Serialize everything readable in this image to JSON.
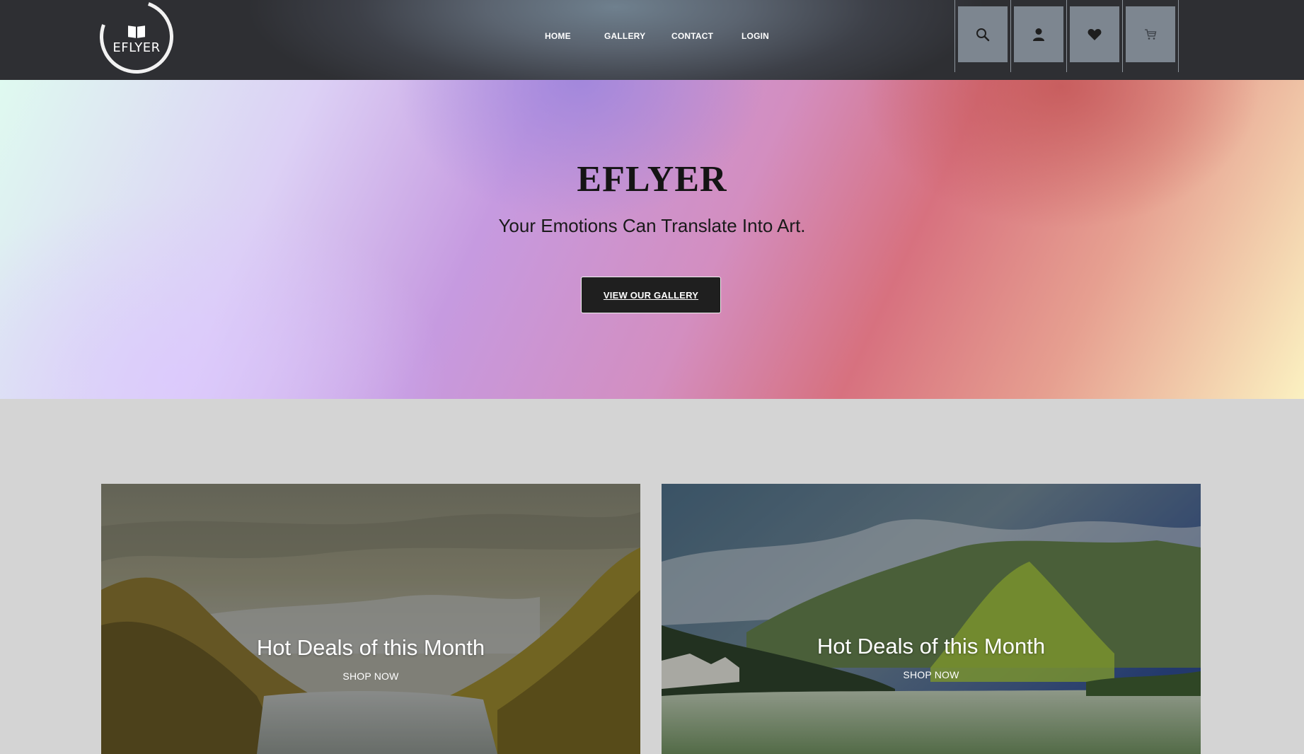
{
  "header": {
    "logo_text": "EFLYER",
    "nav": [
      {
        "label": "HOME"
      },
      {
        "label": "GALLERY"
      },
      {
        "label": "CONTACT"
      },
      {
        "label": "LOGIN"
      }
    ],
    "icons": [
      "search-icon",
      "user-icon",
      "heart-icon",
      "cart-icon"
    ]
  },
  "hero": {
    "title": "EFLYER",
    "subtitle": "Your Emotions Can Translate Into Art.",
    "button": "VIEW OUR GALLERY"
  },
  "cards": [
    {
      "title": "Hot Deals of this Month",
      "link": "SHOP NOW"
    },
    {
      "title": "Hot Deals of this Month",
      "link": "SHOP NOW"
    }
  ],
  "colors": {
    "header_dark": "#2e2f33",
    "icon_button": "#7d8690",
    "page_bg": "#d4d4d4",
    "hero_button": "#1f1f1f"
  }
}
